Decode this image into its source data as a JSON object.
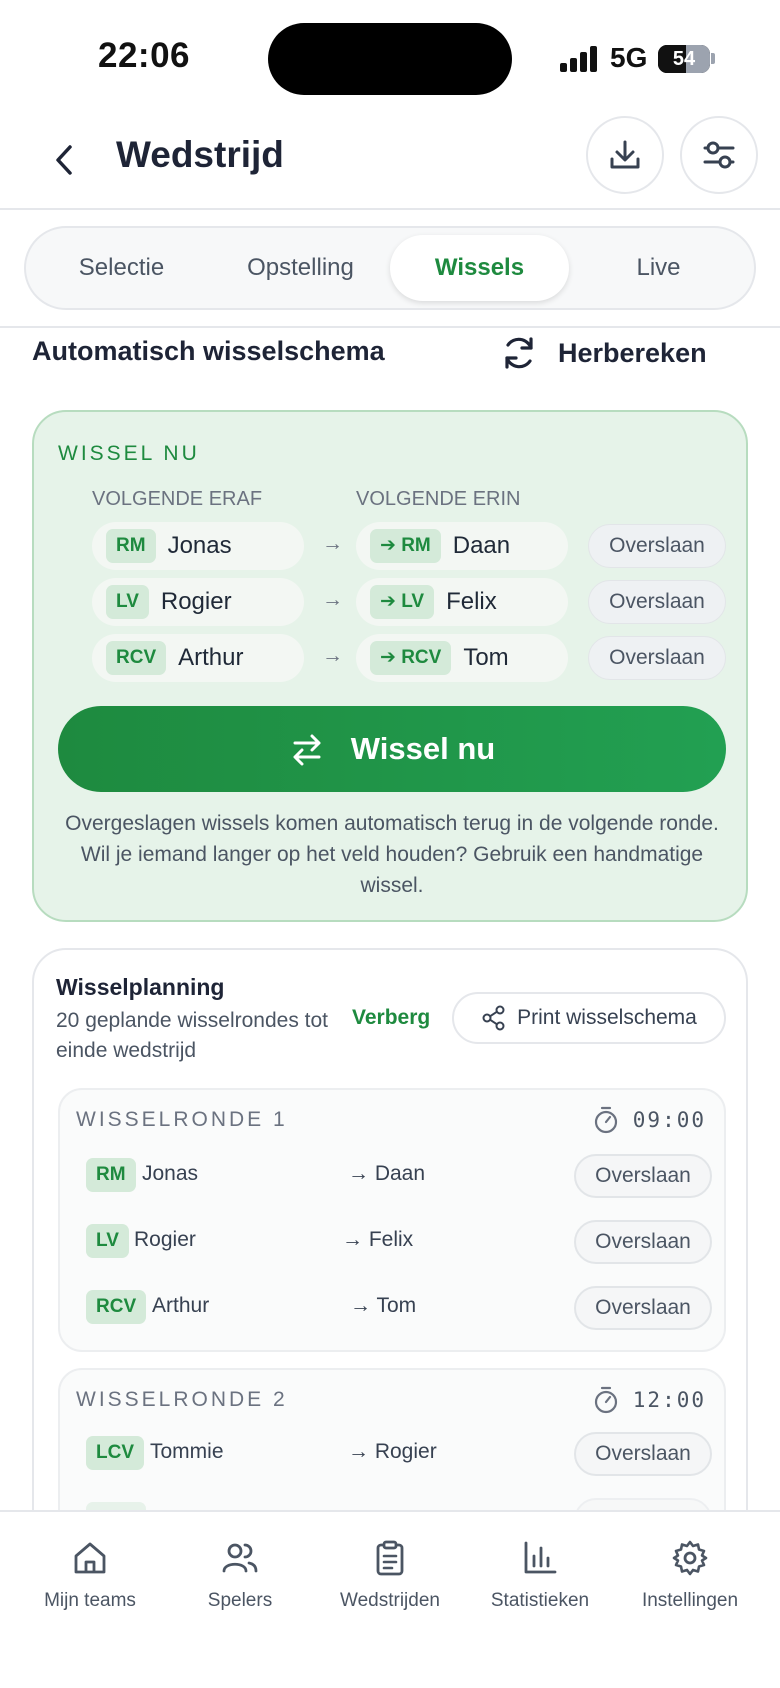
{
  "status_bar": {
    "time": "22:06",
    "network": "5G",
    "battery": "54",
    "battery_level": 0.54
  },
  "header": {
    "title": "Wedstrijd",
    "back_icon": "chevron-left-icon",
    "download_icon": "download-icon",
    "filter_icon": "sliders-icon"
  },
  "tabs": [
    {
      "label": "Selectie",
      "active": false
    },
    {
      "label": "Opstelling",
      "active": false
    },
    {
      "label": "Wissels",
      "active": true
    },
    {
      "label": "Live",
      "active": false
    }
  ],
  "section": {
    "title": "Automatisch wisselschema",
    "recalc_label": "Herbereken"
  },
  "now": {
    "label": "WISSEL NU",
    "col_off": "VOLGENDE ERAF",
    "col_on": "VOLGENDE ERIN",
    "arrow": "→",
    "rows": [
      {
        "pos": "RM",
        "off": "Jonas",
        "on_badge": "➔ RM",
        "on": "Daan",
        "skip": "Overslaan"
      },
      {
        "pos": "LV",
        "off": "Rogier",
        "on_badge": "➔ LV",
        "on": "Felix",
        "skip": "Overslaan"
      },
      {
        "pos": "RCV",
        "off": "Arthur",
        "on_badge": "➔ RCV",
        "on": "Tom",
        "skip": "Overslaan"
      }
    ],
    "button_label": "Wissel nu",
    "note": "Overgeslagen wissels komen automatisch terug in de volgende ronde. Wil je iemand langer op het veld houden? Gebruik een handmatige wissel."
  },
  "planning": {
    "title": "Wisselplanning",
    "subtitle": "20 geplande wisselrondes tot einde wedstrijd",
    "hide_label": "Verberg",
    "print_label": "Print wisselschema",
    "rounds": [
      {
        "title": "WISSELRONDE 1",
        "time": "09:00",
        "rows": [
          {
            "pos": "RM",
            "off": "Jonas",
            "on": "→ Daan",
            "skip": "Overslaan"
          },
          {
            "pos": "LV",
            "off": "Rogier",
            "on": "→ Felix",
            "skip": "Overslaan"
          },
          {
            "pos": "RCV",
            "off": "Arthur",
            "on": "→ Tom",
            "skip": "Overslaan"
          }
        ]
      },
      {
        "title": "WISSELRONDE 2",
        "time": "12:00",
        "rows": [
          {
            "pos": "LCV",
            "off": "Tommie",
            "on": "→ Rogier",
            "skip": "Overslaan"
          }
        ]
      }
    ]
  },
  "nav": [
    {
      "label": "Mijn teams",
      "icon": "home-icon"
    },
    {
      "label": "Spelers",
      "icon": "users-icon"
    },
    {
      "label": "Wedstrijden",
      "icon": "clipboard-icon"
    },
    {
      "label": "Statistieken",
      "icon": "bar-chart-icon"
    },
    {
      "label": "Instellingen",
      "icon": "gear-icon"
    }
  ],
  "colors": {
    "accent": "#1e8a3f",
    "card_bg": "#e6f3e9",
    "badge_bg": "#d4ead9",
    "text": "#1e2436"
  }
}
